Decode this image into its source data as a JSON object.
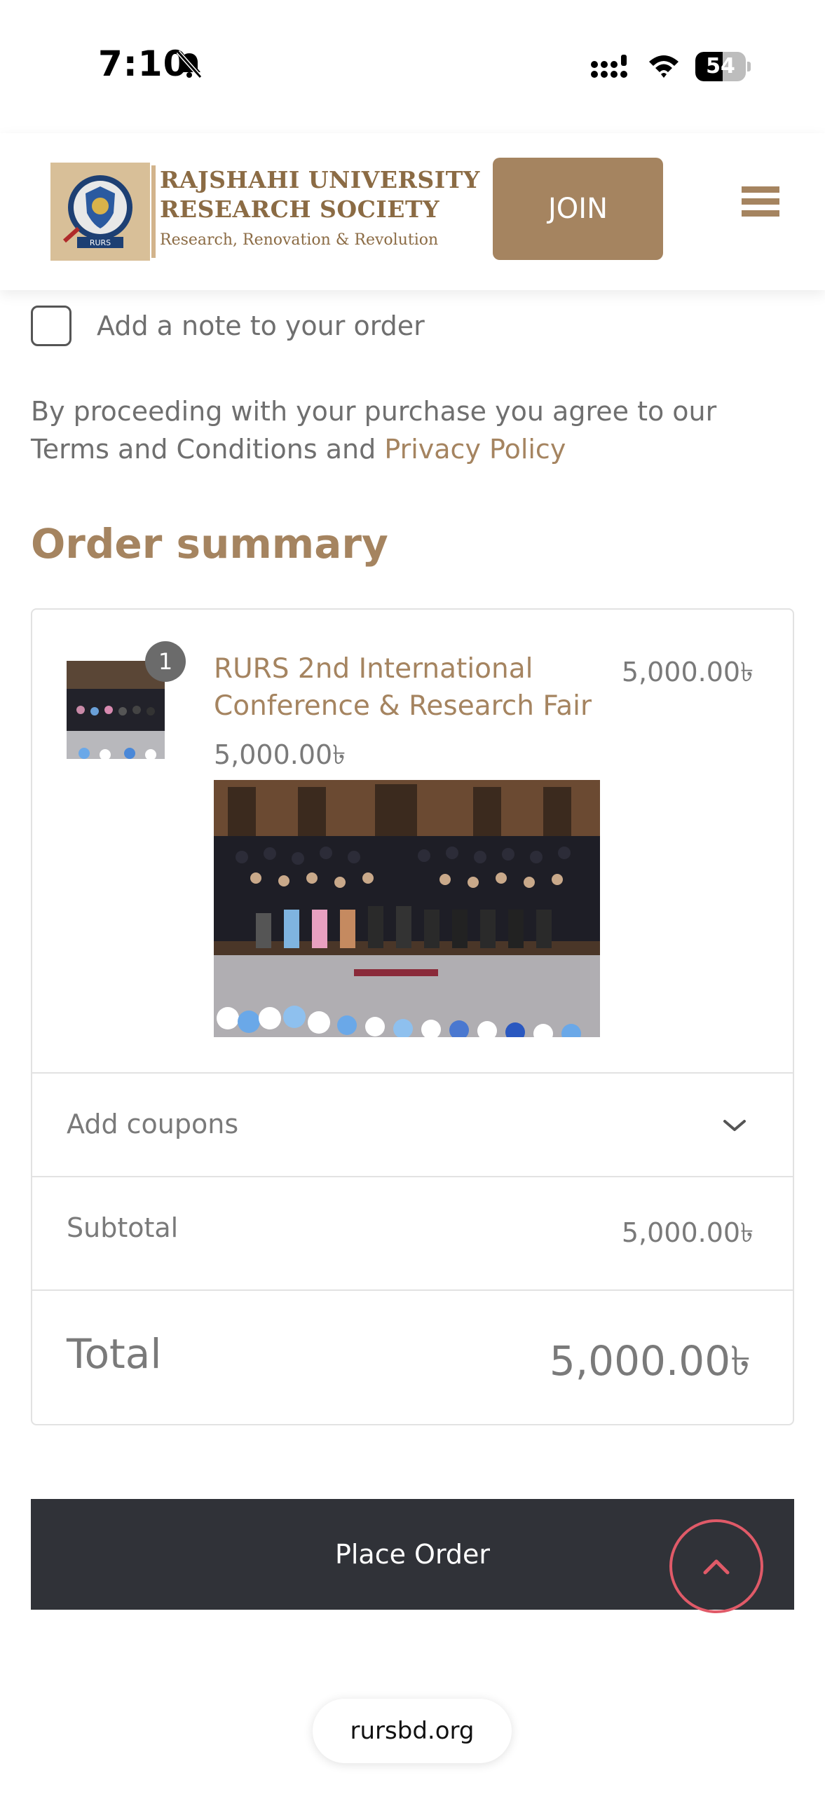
{
  "status_bar": {
    "time": "7:10",
    "battery_level": "54",
    "icons": [
      "bell-slash-icon",
      "signal-icon",
      "wifi-icon",
      "battery-icon"
    ]
  },
  "header": {
    "logo_line1": "RAJSHAHI UNIVERSITY",
    "logo_line2": "RESEARCH SOCIETY",
    "logo_tagline": "Research, Renovation & Revolution",
    "logo_emblem_text": "RURS",
    "join_label": "JOIN",
    "menu_icon": "hamburger-menu-icon"
  },
  "checkout": {
    "note_label": "Add a note to your order",
    "terms_text": "By proceeding with your purchase you agree to our Terms and Conditions and ",
    "privacy_link": "Privacy Policy"
  },
  "order_summary": {
    "title": "Order summary",
    "item": {
      "quantity": "1",
      "name": "RURS 2nd International Conference & Research Fair",
      "line_price": "5,000.00৳",
      "unit_price": "5,000.00৳"
    },
    "coupons_label": "Add coupons",
    "subtotal_label": "Subtotal",
    "subtotal_value": "5,000.00৳",
    "total_label": "Total",
    "total_value": "5,000.00৳"
  },
  "actions": {
    "place_order_label": "Place Order",
    "scroll_top_icon": "chevron-up-icon"
  },
  "browser": {
    "url": "rursbd.org"
  },
  "colors": {
    "brand": "#a58460",
    "dark_button": "#303238",
    "scroll_ring": "#e05a68"
  }
}
